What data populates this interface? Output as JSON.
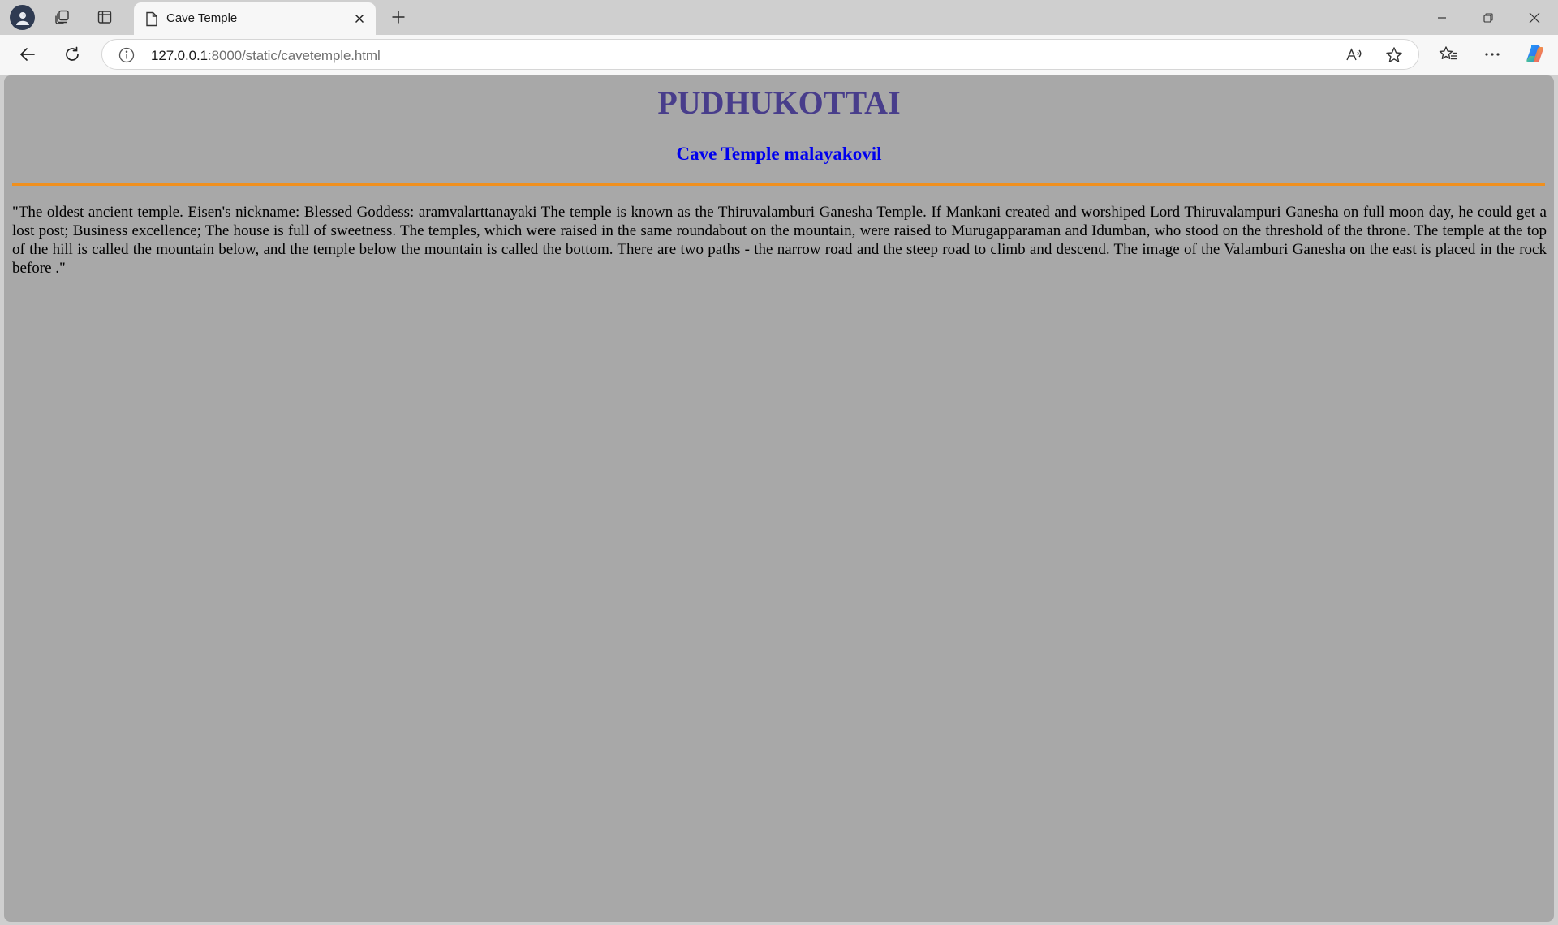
{
  "browser": {
    "tab": {
      "title": "Cave Temple",
      "icon": "document-icon"
    },
    "address": {
      "host": "127.0.0.1",
      "path": ":8000/static/cavetemple.html"
    },
    "icons": {
      "profile": "profile-avatar-icon",
      "workspaces": "workspaces-icon",
      "vertical_tabs": "tab-actions-icon",
      "back": "back-arrow-icon",
      "refresh": "refresh-icon",
      "site_info": "info-icon",
      "read_aloud": "read-aloud-icon",
      "favorite": "star-icon",
      "favorites": "favorites-icon",
      "more": "more-icon",
      "copilot": "copilot-icon"
    }
  },
  "page": {
    "background": "#a8a8a8",
    "title": "PUDHUKOTTAI",
    "title_color": "#483d8b",
    "subtitle": "Cave Temple malayakovil",
    "subtitle_color": "#0000ee",
    "rule_color": "#f0901e",
    "paragraph": "\"The oldest ancient temple. Eisen's nickname: Blessed Goddess: aramvalarttanayaki The temple is known as the Thiruvalamburi Ganesha Temple. If Mankani created and worshiped Lord Thiruvalampuri Ganesha on full moon day, he could get a lost post; Business excellence; The house is full of sweetness. The temples, which were raised in the same roundabout on the mountain, were raised to Murugapparaman and Idumban, who stood on the threshold of the throne. The temple at the top of the hill is called the mountain below, and the temple below the mountain is called the bottom. There are two paths - the narrow road and the steep road to climb and descend. The image of the Valamburi Ganesha on the east is placed in the rock before .\""
  }
}
